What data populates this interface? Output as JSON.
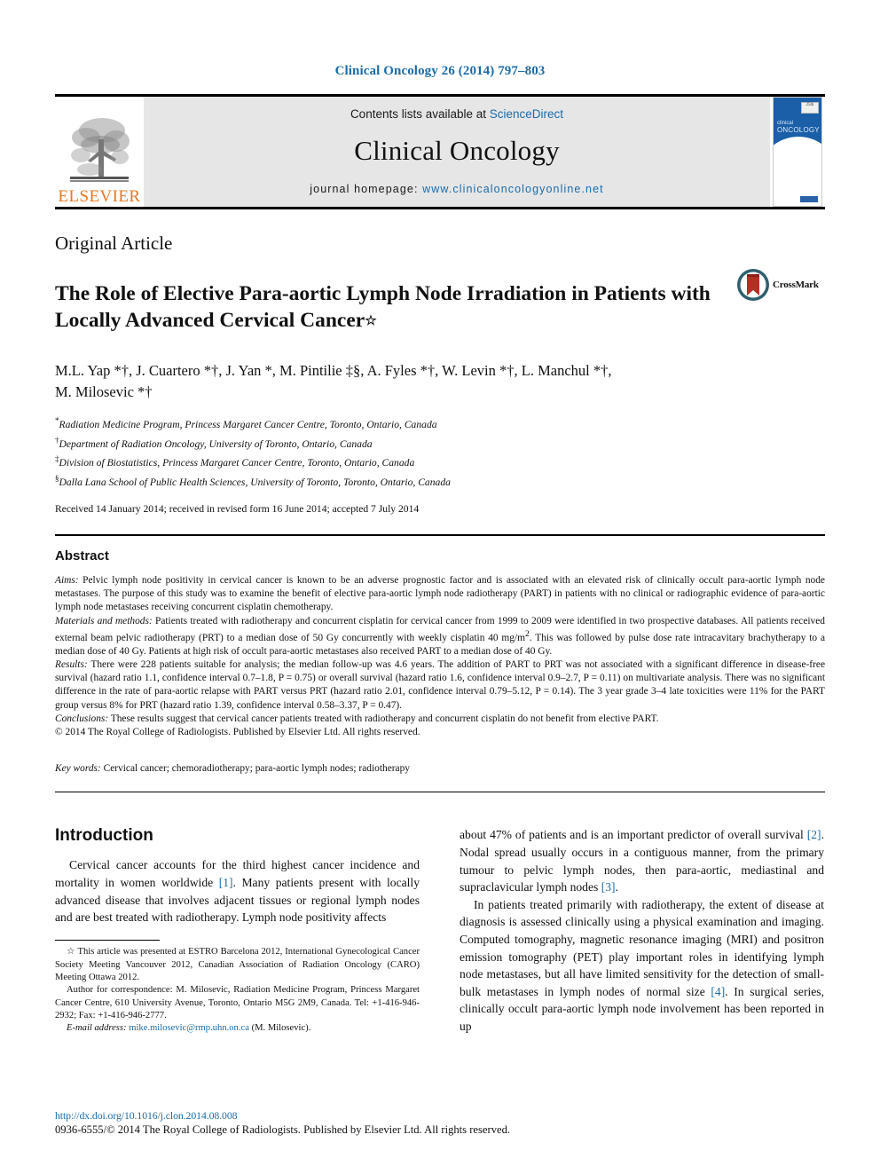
{
  "running_head": "Clinical Oncology 26 (2014) 797–803",
  "masthead": {
    "publisher": "ELSEVIER",
    "contents_prefix": "Contents lists available at ",
    "contents_link": "ScienceDirect",
    "journal_name": "Clinical Oncology",
    "homepage_prefix": "journal homepage: ",
    "homepage_url": "www.clinicaloncologyonline.net",
    "cover_title_line1": "clinical",
    "cover_title_line2": "ONCOLOGY",
    "cover_badge": "25th"
  },
  "article": {
    "type": "Original Article",
    "title": "The Role of Elective Para-aortic Lymph Node Irradiation in Patients with Locally Advanced Cervical Cancer",
    "title_marker": "☆",
    "crossmark_label": "CrossMark",
    "authors_line1": "M.L. Yap *†, J. Cuartero *†, J. Yan *, M. Pintilie ‡§, A. Fyles *†, W. Levin *†, L. Manchul *†,",
    "authors_line2": "M. Milosevic *†",
    "affiliations": [
      {
        "marker": "*",
        "text": "Radiation Medicine Program, Princess Margaret Cancer Centre, Toronto, Ontario, Canada"
      },
      {
        "marker": "†",
        "text": "Department of Radiation Oncology, University of Toronto, Ontario, Canada"
      },
      {
        "marker": "‡",
        "text": "Division of Biostatistics, Princess Margaret Cancer Centre, Toronto, Ontario, Canada"
      },
      {
        "marker": "§",
        "text": "Dalla Lana School of Public Health Sciences, University of Toronto, Toronto, Ontario, Canada"
      }
    ],
    "history": "Received 14 January 2014; received in revised form 16 June 2014; accepted 7 July 2014"
  },
  "abstract": {
    "heading": "Abstract",
    "aims_label": "Aims:",
    "aims_text": " Pelvic lymph node positivity in cervical cancer is known to be an adverse prognostic factor and is associated with an elevated risk of clinically occult para-aortic lymph node metastases. The purpose of this study was to examine the benefit of elective para-aortic lymph node radiotherapy (PART) in patients with no clinical or radiographic evidence of para-aortic lymph node metastases receiving concurrent cisplatin chemotherapy.",
    "methods_label": "Materials and methods:",
    "methods_text_a": " Patients treated with radiotherapy and concurrent cisplatin for cervical cancer from 1999 to 2009 were identified in two prospective databases. All patients received external beam pelvic radiotherapy (PRT) to a median dose of 50 Gy concurrently with weekly cisplatin 40 mg/m",
    "methods_sup": "2",
    "methods_text_b": ". This was followed by pulse dose rate intracavitary brachytherapy to a median dose of 40 Gy. Patients at high risk of occult para-aortic metastases also received PART to a median dose of 40 Gy.",
    "results_label": "Results:",
    "results_text": " There were 228 patients suitable for analysis; the median follow-up was 4.6 years. The addition of PART to PRT was not associated with a significant difference in disease-free survival (hazard ratio 1.1, confidence interval 0.7–1.8, P = 0.75) or overall survival (hazard ratio 1.6, confidence interval 0.9–2.7, P = 0.11) on multivariate analysis. There was no significant difference in the rate of para-aortic relapse with PART versus PRT (hazard ratio 2.01, confidence interval 0.79–5.12, P = 0.14). The 3 year grade 3–4 late toxicities were 11% for the PART group versus 8% for PRT (hazard ratio 1.39, confidence interval 0.58–3.37, P = 0.47).",
    "conclusions_label": "Conclusions:",
    "conclusions_text": " These results suggest that cervical cancer patients treated with radiotherapy and concurrent cisplatin do not benefit from elective PART.",
    "copyright_line": "© 2014 The Royal College of Radiologists. Published by Elsevier Ltd. All rights reserved.",
    "keywords_label": "Key words:",
    "keywords_text": " Cervical cancer; chemoradiotherapy; para-aortic lymph nodes; radiotherapy"
  },
  "introduction": {
    "heading": "Introduction",
    "para1_a": "Cervical cancer accounts for the third highest cancer incidence and mortality in women worldwide ",
    "para1_ref1": "[1]",
    "para1_b": ". Many patients present with locally advanced disease that involves adjacent tissues or regional lymph nodes and are best treated with radiotherapy. Lymph node positivity affects about 47% of patients and is an important predictor of overall survival ",
    "para1_ref2": "[2]",
    "para1_c": ". Nodal spread usually occurs in a contiguous manner, from the primary tumour to pelvic lymph nodes, then para-aortic, mediastinal and supraclavicular lymph nodes ",
    "para1_ref3": "[3]",
    "para1_d": ".",
    "para2_a": "In patients treated primarily with radiotherapy, the extent of disease at diagnosis is assessed clinically using a physical examination and imaging. Computed tomography, magnetic resonance imaging (MRI) and positron emission tomography (PET) play important roles in identifying lymph node metastases, but all have limited sensitivity for the detection of small-bulk metastases in lymph nodes of normal size ",
    "para2_ref4": "[4]",
    "para2_b": ". In surgical series, clinically occult para-aortic lymph node involvement has been reported in up"
  },
  "footnotes": {
    "star_marker": "☆",
    "star_text": " This article was presented at ESTRO Barcelona 2012, International Gynecological Cancer Society Meeting Vancouver 2012, Canadian Association of Radiation Oncology (CARO) Meeting Ottawa 2012.",
    "correspondence": "Author for correspondence: M. Milosevic, Radiation Medicine Program, Princess Margaret Cancer Centre, 610 University Avenue, Toronto, Ontario M5G 2M9, Canada. Tel: +1-416-946-2932; Fax: +1-416-946-2777.",
    "email_label": "E-mail address:",
    "email": "mike.milosevic@rmp.uhn.on.ca",
    "email_suffix": " (M. Milosevic)."
  },
  "page_footer": {
    "doi": "http://dx.doi.org/10.1016/j.clon.2014.08.008",
    "copyright": "0936-6555/© 2014 The Royal College of Radiologists. Published by Elsevier Ltd. All rights reserved."
  },
  "colors": {
    "link": "#1b6ca8",
    "elsevier_orange": "#E87722",
    "cover_blue": "#1a5fa8"
  }
}
